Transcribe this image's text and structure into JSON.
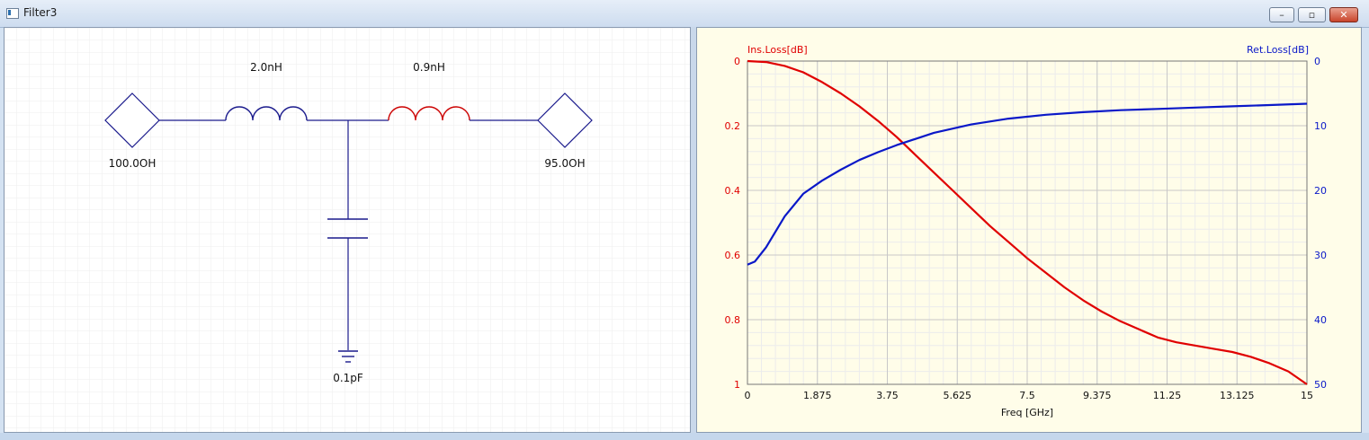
{
  "window": {
    "title": "Filter3",
    "minimize_glyph": "–",
    "restore_glyph": "▫",
    "close_glyph": "✕"
  },
  "schematic": {
    "inductor1_label": "2.0nH",
    "inductor2_label": "0.9nH",
    "capacitor_label": "0.1pF",
    "source_label": "100.0OH",
    "load_label": "95.0OH",
    "colors": {
      "wire": "#1a1a8c",
      "inductor1": "#1a1a8c",
      "inductor2": "#cc0000",
      "grid": "#e6e6e6"
    }
  },
  "chart_data": {
    "type": "line",
    "xlabel": "Freq [GHz]",
    "ylabel_left": "Ins.Loss[dB]",
    "ylabel_right": "Ret.Loss[dB]",
    "xlim": [
      0,
      15
    ],
    "ylim_left": [
      0,
      1
    ],
    "ylim_right": [
      0,
      50
    ],
    "left_axis_inverted": true,
    "right_axis_inverted": true,
    "x_ticks": [
      "0",
      "1.875",
      "3.75",
      "5.625",
      "7.5",
      "9.375",
      "11.25",
      "13.125",
      "15"
    ],
    "y_ticks_left": [
      "0",
      "0.2",
      "0.4",
      "0.6",
      "0.8",
      "1"
    ],
    "y_ticks_right": [
      "0",
      "10",
      "20",
      "30",
      "40",
      "50"
    ],
    "grid": true,
    "series": [
      {
        "axis": "left",
        "color": "#e00000",
        "x": [
          0,
          0.5,
          1,
          1.5,
          2,
          2.5,
          3,
          3.5,
          4,
          4.5,
          5,
          5.5,
          6,
          6.5,
          7,
          7.5,
          8,
          8.5,
          9,
          9.5,
          10,
          10.5,
          11,
          11.5,
          12,
          12.5,
          13,
          13.5,
          14,
          14.5,
          15
        ],
        "y": [
          0.0,
          0.003,
          0.015,
          0.035,
          0.065,
          0.1,
          0.14,
          0.185,
          0.235,
          0.29,
          0.345,
          0.4,
          0.455,
          0.51,
          0.56,
          0.61,
          0.655,
          0.7,
          0.74,
          0.775,
          0.805,
          0.83,
          0.855,
          0.87,
          0.88,
          0.89,
          0.9,
          0.915,
          0.935,
          0.96,
          1.0
        ]
      },
      {
        "axis": "right",
        "color": "#0a18c8",
        "x": [
          0,
          0.2,
          0.5,
          1,
          1.5,
          2,
          2.5,
          3,
          3.5,
          4,
          5,
          6,
          7,
          8,
          9,
          10,
          11,
          12,
          13,
          14,
          15
        ],
        "y": [
          31.5,
          31,
          28.8,
          24,
          20.5,
          18.5,
          16.8,
          15.3,
          14.1,
          13.0,
          11.1,
          9.8,
          8.9,
          8.3,
          7.9,
          7.6,
          7.4,
          7.2,
          7.0,
          6.8,
          6.6
        ]
      }
    ]
  }
}
